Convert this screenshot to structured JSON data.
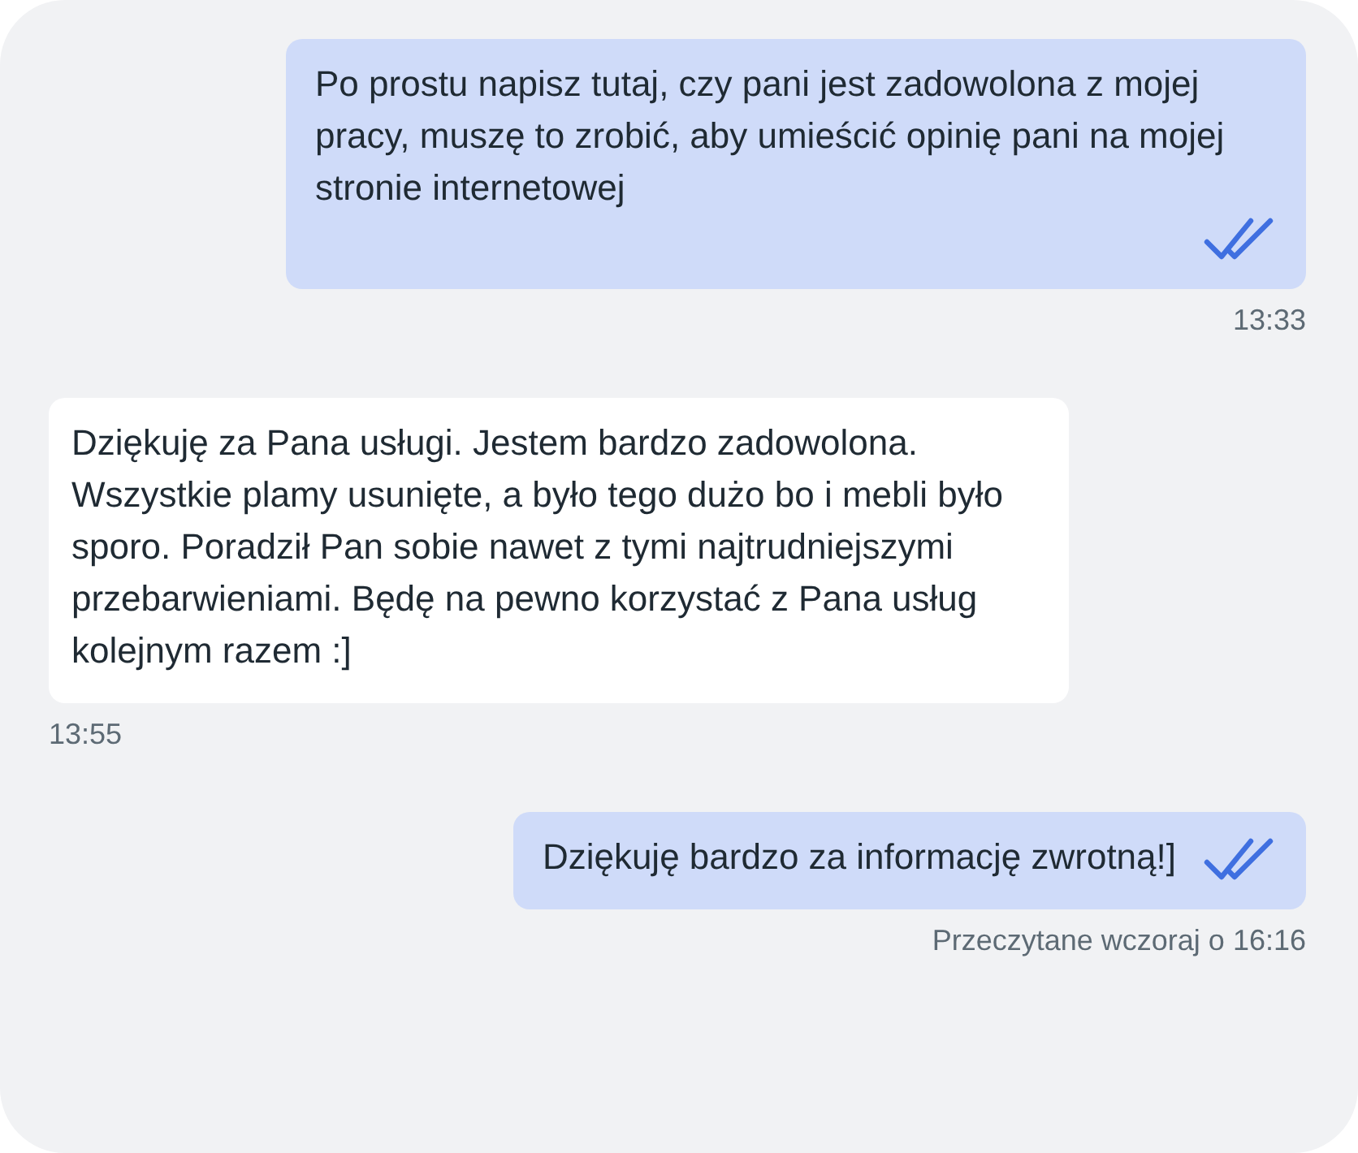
{
  "messages": [
    {
      "kind": "outgoing",
      "text": "Po prostu napisz tutaj, czy pani jest zadowolona z mojej pracy, muszę to zrobić, aby umieścić opinię pani na mojej stronie internetowej",
      "read": true,
      "meta": "13:33"
    },
    {
      "kind": "incoming",
      "text": "Dziękuję za Pana usługi. Jestem bardzo zadowolona. Wszystkie plamy usunięte, a było tego dużo bo i mebli było sporo. Poradził Pan sobie nawet z tymi najtrudniejszymi przebarwieniami. Będę na pewno korzystać z Pana usług kolejnym razem :]",
      "meta": "13:55"
    },
    {
      "kind": "outgoing",
      "text": "Dziękuję bardzo za informację zwrotną!]",
      "read": true,
      "meta": "Przeczytane wczoraj o 16:16"
    }
  ]
}
